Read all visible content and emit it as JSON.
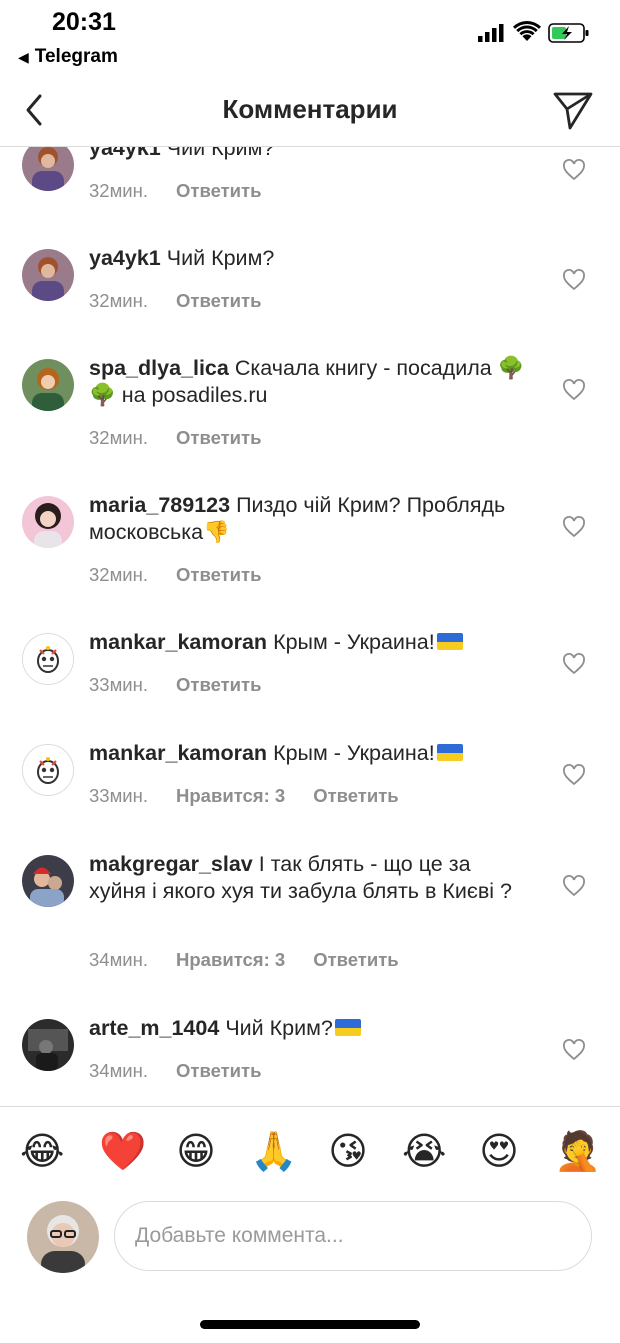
{
  "status_bar": {
    "time": "20:31",
    "back_app": "Telegram"
  },
  "header": {
    "title": "Комментарии"
  },
  "comments": [
    {
      "user": "ya4yk1",
      "text": "Чий Крим?",
      "time": "32мин.",
      "likes": "",
      "reply": "Ответить"
    },
    {
      "user": "ya4yk1",
      "text": "Чий Крим?",
      "time": "32мин.",
      "likes": "",
      "reply": "Ответить"
    },
    {
      "user": "spa_dlya_lica",
      "text_before": "Скачала книгу - посадила ",
      "tree1": "🌳",
      "tree2": "🌳",
      "text_after": " на posadiles.ru",
      "time": "32мин.",
      "likes": "",
      "reply": "Ответить"
    },
    {
      "user": "maria_789123",
      "text": "Пиздо чій Крим? Проблядь московська",
      "emoji": "👎",
      "time": "32мин.",
      "likes": "",
      "reply": "Ответить"
    },
    {
      "user": "mankar_kamoran",
      "text": "Крым - Украина!",
      "time": "33мин.",
      "likes": "",
      "reply": "Ответить"
    },
    {
      "user": "mankar_kamoran",
      "text": "Крым - Украина!",
      "time": "33мин.",
      "likes": "Нравится: 3",
      "reply": "Ответить"
    },
    {
      "user": "makgregar_slav",
      "text": "І так блять - що це за хуйня і якого хуя ти забула блять в Києві ?",
      "time": "34мин.",
      "likes": "Нравится: 3",
      "reply": "Ответить"
    },
    {
      "user": "arte_m_1404",
      "text": "Чий Крим?",
      "time": "34мин.",
      "likes": "",
      "reply": "Ответить"
    }
  ],
  "emoji_bar": [
    "😂",
    "❤️",
    "😁",
    "🙏",
    "😘",
    "😭",
    "😍",
    "🤦"
  ],
  "composer": {
    "placeholder": "Добавьте коммента..."
  },
  "colors": {
    "text": "#262626",
    "meta": "#8e8e8e",
    "divider": "#dbdbdb",
    "flag_blue": "#2f6bd6",
    "flag_yellow": "#f5cc1f"
  }
}
